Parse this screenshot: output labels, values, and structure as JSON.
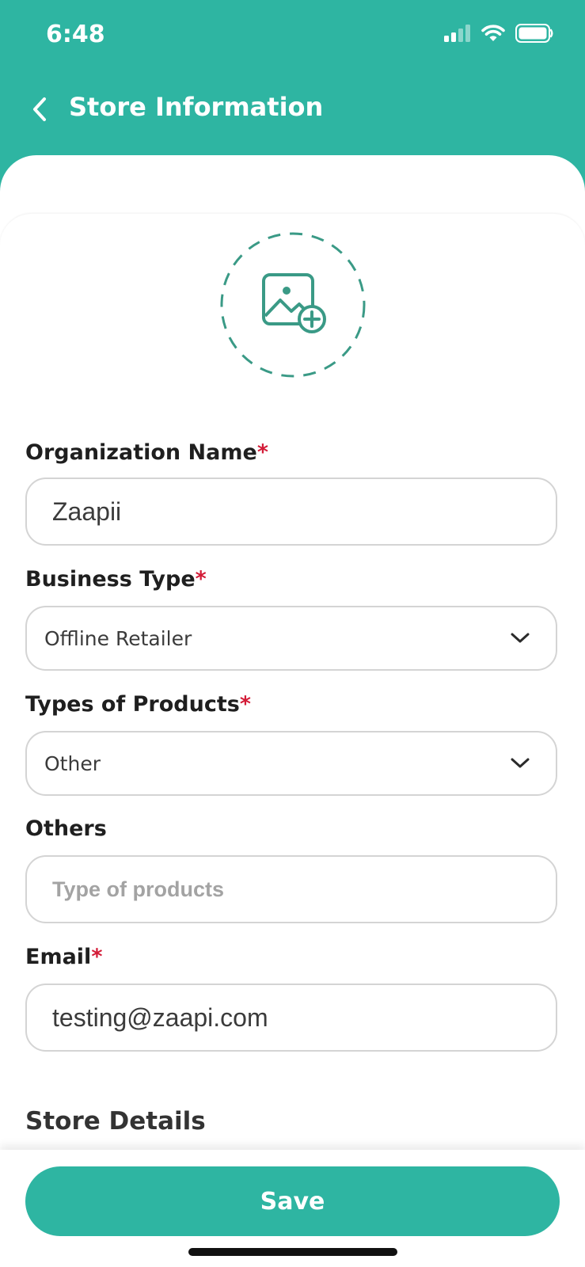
{
  "status_bar": {
    "time": "6:48"
  },
  "header": {
    "title": "Store Information"
  },
  "form": {
    "organization_name": {
      "label": "Organization Name",
      "required_mark": "*",
      "value": "Zaapii"
    },
    "business_type": {
      "label": "Business Type",
      "required_mark": "*",
      "selected": "Offline Retailer"
    },
    "types_of_products": {
      "label": "Types of Products",
      "required_mark": "*",
      "selected": "Other"
    },
    "others": {
      "label": "Others",
      "placeholder": "Type of products"
    },
    "email": {
      "label": "Email",
      "required_mark": "*",
      "value": "testing@zaapi.com"
    }
  },
  "store_details": {
    "title": "Store Details"
  },
  "actions": {
    "save_label": "Save"
  },
  "colors": {
    "primary": "#2eb5a2",
    "required": "#d31b37",
    "icon_stroke": "#3a9a86"
  },
  "icons": {
    "back": "chevron-left-icon",
    "image_add": "image-add-icon",
    "dropdown": "chevron-down-icon",
    "signal": "cellular-signal-icon",
    "wifi": "wifi-icon",
    "battery": "battery-icon"
  }
}
